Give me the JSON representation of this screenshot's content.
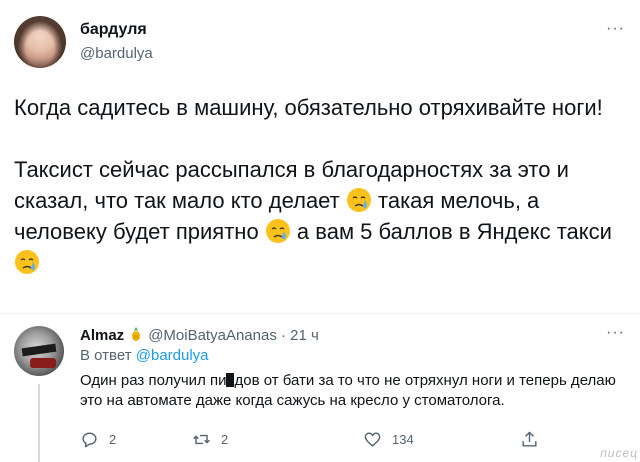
{
  "main_tweet": {
    "display_name": "бардуля",
    "handle": "@bardulya",
    "paragraph1": "Когда садитесь в машину, обязательно отряхивайте ноги!",
    "p2_part1": "Таксист сейчас рассыпался в благодарностях за это и сказал, что так мало кто делает",
    "p2_part2": " такая мелочь, а человеку будет приятно",
    "p2_part3": " а вам 5 баллов в Яндекс такси",
    "emoji_name": "face-holding-back-tears-icon"
  },
  "reply_tweet": {
    "display_name": "Almaz",
    "handle": "@MoiBatyaAnanas",
    "separator": "·",
    "time": "21 ч",
    "reply_prefix": "В ответ",
    "reply_to": "@bardulya",
    "text_part1": "Один раз получил пи",
    "text_part2": "дов от бати за то что не отряхнул ноги и теперь делаю это на автомате даже когда сажусь на кресло у стоматолога.",
    "reply_count": "2",
    "retweet_count": "2",
    "like_count": "134"
  },
  "watermark": "писец",
  "colors": {
    "text": "#0f1419",
    "secondary": "#536471",
    "link": "#1d9bf0",
    "divider": "#eff3f4"
  }
}
